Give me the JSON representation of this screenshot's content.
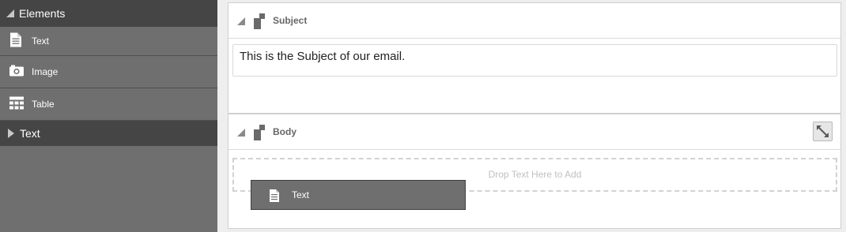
{
  "sidebar": {
    "header": "Elements",
    "items": [
      {
        "label": "Text",
        "icon": "document-icon"
      },
      {
        "label": "Image",
        "icon": "camera-icon"
      },
      {
        "label": "Table",
        "icon": "table-icon"
      }
    ],
    "collapsed_section": "Text"
  },
  "panels": {
    "subject": {
      "title": "Subject",
      "value": "This is the Subject of our email."
    },
    "body": {
      "title": "Body",
      "drop_hint": "Drop Text Here to Add",
      "dragging_item": "Text"
    }
  },
  "colors": {
    "sidebar_bg": "#6f6f6f",
    "sidebar_header_bg": "#454545",
    "canvas_bg": "#eeeeee"
  }
}
